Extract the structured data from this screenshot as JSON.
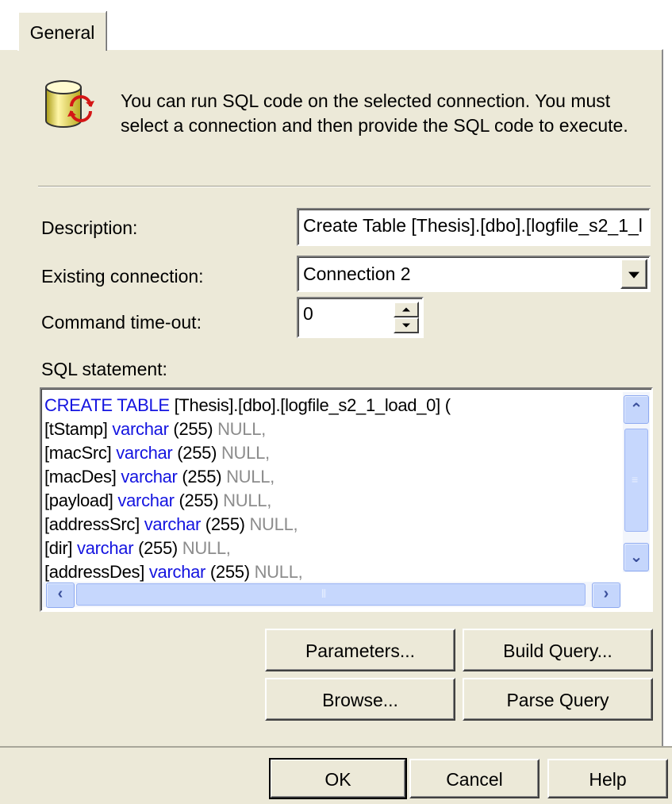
{
  "tabs": [
    {
      "label": "General"
    }
  ],
  "info_text_line1": "You can run SQL code on the selected connection.  You must",
  "info_text_line2": "select a connection and then provide the SQL code to execute.",
  "fields": {
    "description": {
      "label": "Description:",
      "value": "Create Table [Thesis].[dbo].[logfile_s2_1_l"
    },
    "connection": {
      "label": "Existing connection:",
      "value": "Connection 2"
    },
    "timeout": {
      "label": "Command time-out:",
      "value": "0"
    }
  },
  "sql": {
    "label": "SQL statement:",
    "lines": [
      [
        {
          "t": "CREATE TABLE",
          "c": "kw"
        },
        {
          "t": " [Thesis].[dbo].[logfile_s2_1_load_0] (",
          "c": "plain"
        }
      ],
      [
        {
          "t": "[tStamp] ",
          "c": "plain"
        },
        {
          "t": "varchar",
          "c": "kw"
        },
        {
          "t": " (255) ",
          "c": "plain"
        },
        {
          "t": "NULL,",
          "c": "nul"
        }
      ],
      [
        {
          "t": "[macSrc] ",
          "c": "plain"
        },
        {
          "t": "varchar",
          "c": "kw"
        },
        {
          "t": " (255) ",
          "c": "plain"
        },
        {
          "t": "NULL,",
          "c": "nul"
        }
      ],
      [
        {
          "t": "[macDes] ",
          "c": "plain"
        },
        {
          "t": "varchar",
          "c": "kw"
        },
        {
          "t": " (255) ",
          "c": "plain"
        },
        {
          "t": "NULL,",
          "c": "nul"
        }
      ],
      [
        {
          "t": "[payload] ",
          "c": "plain"
        },
        {
          "t": "varchar",
          "c": "kw"
        },
        {
          "t": " (255) ",
          "c": "plain"
        },
        {
          "t": "NULL,",
          "c": "nul"
        }
      ],
      [
        {
          "t": "[addressSrc] ",
          "c": "plain"
        },
        {
          "t": "varchar",
          "c": "kw"
        },
        {
          "t": " (255) ",
          "c": "plain"
        },
        {
          "t": "NULL,",
          "c": "nul"
        }
      ],
      [
        {
          "t": "[dir] ",
          "c": "plain"
        },
        {
          "t": "varchar",
          "c": "kw"
        },
        {
          "t": " (255) ",
          "c": "plain"
        },
        {
          "t": "NULL,",
          "c": "nul"
        }
      ],
      [
        {
          "t": "[addressDes] ",
          "c": "plain"
        },
        {
          "t": "varchar",
          "c": "kw"
        },
        {
          "t": " (255) ",
          "c": "plain"
        },
        {
          "t": "NULL,",
          "c": "nul"
        }
      ]
    ]
  },
  "buttons": {
    "parameters": "Parameters...",
    "build_query": "Build Query...",
    "browse": "Browse...",
    "parse_query": "Parse Query",
    "ok": "OK",
    "cancel": "Cancel",
    "help": "Help"
  },
  "colors": {
    "keyword": "#1414e0",
    "null_keyword": "#8c8c8c",
    "dialog_bg": "#ece9d8"
  },
  "icons": [
    "database-refresh-icon",
    "dropdown-arrow-icon",
    "spin-up-icon",
    "spin-down-icon",
    "scroll-up-icon",
    "scroll-down-icon",
    "scroll-left-icon",
    "scroll-right-icon"
  ]
}
